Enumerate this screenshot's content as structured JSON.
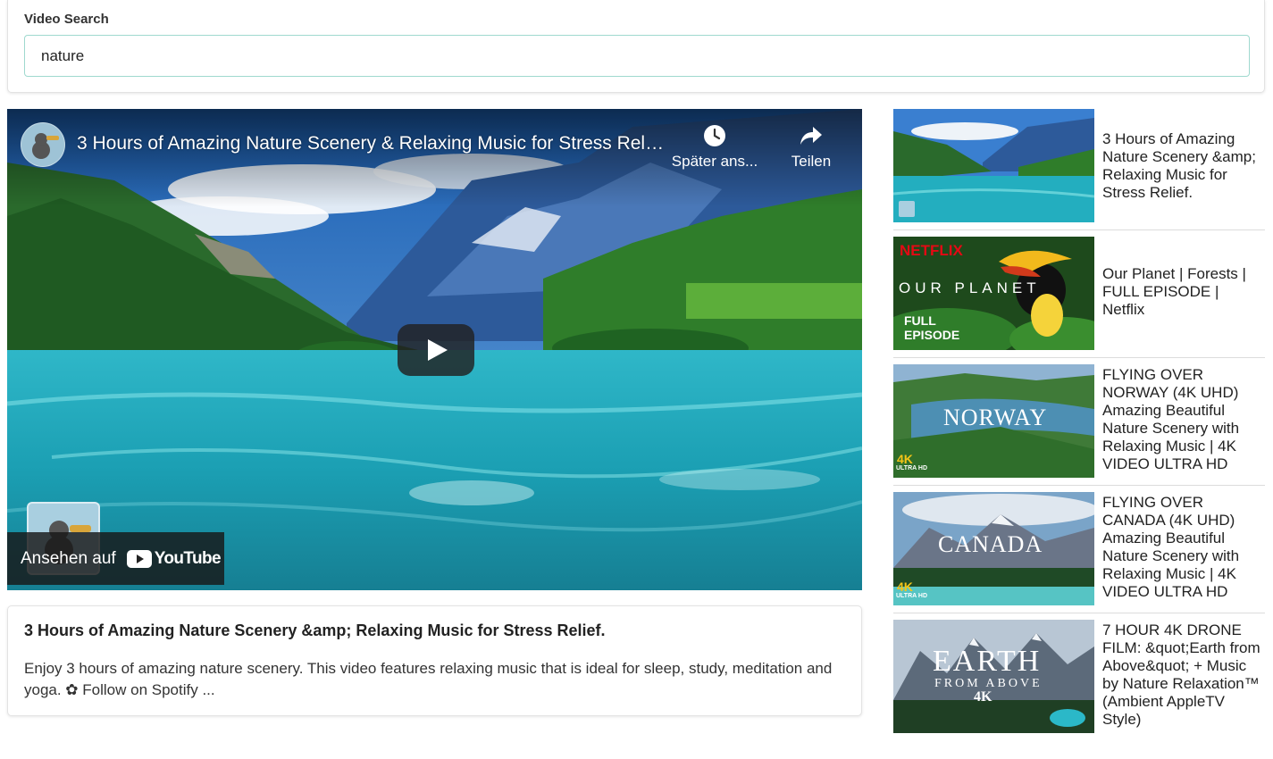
{
  "search": {
    "label": "Video Search",
    "value": "nature"
  },
  "player": {
    "title": "3 Hours of Amazing Nature Scenery & Relaxing Music for Stress Relief.",
    "watch_later_label": "Später ans...",
    "share_label": "Teilen",
    "watch_on_label": "Ansehen auf",
    "youtube_label": "YouTube",
    "icons": [
      "clock-icon",
      "share-arrow-icon",
      "play-icon",
      "youtube-logo-icon"
    ]
  },
  "description": {
    "title": "3 Hours of Amazing Nature Scenery &amp; Relaxing Music for Stress Relief.",
    "body": "Enjoy 3 hours of amazing nature scenery. This video features relaxing music that is ideal for sleep, study, meditation and yoga. ✿ Follow on Spotify ..."
  },
  "results": [
    {
      "title": "3 Hours of Amazing Nature Scenery &amp; Relaxing Music for Stress Relief.",
      "thumb_text": []
    },
    {
      "title": "Our Planet | Forests | FULL EPISODE | Netflix",
      "thumb_text": [
        "NETFLIX",
        "OUR PLANET",
        "FULL",
        "EPISODE"
      ]
    },
    {
      "title": "FLYING OVER NORWAY (4K UHD) Amazing Beautiful Nature Scenery with Relaxing Music | 4K VIDEO ULTRA HD",
      "thumb_text": [
        "NORWAY",
        "4K",
        "ULTRA HD"
      ]
    },
    {
      "title": "FLYING OVER CANADA (4K UHD) Amazing Beautiful Nature Scenery with Relaxing Music | 4K VIDEO ULTRA HD",
      "thumb_text": [
        "CANADA",
        "4K",
        "ULTRA HD"
      ]
    },
    {
      "title": "7 HOUR 4K DRONE FILM: &quot;Earth from Above&quot; + Music by Nature Relaxation™ (Ambient AppleTV Style)",
      "thumb_text": [
        "EARTH",
        "FROM ABOVE",
        "4K"
      ]
    }
  ],
  "colors": {
    "input_border": "#9fd9cf",
    "netflix_red": "#e50914",
    "uhd_yellow": "#f5c518"
  }
}
